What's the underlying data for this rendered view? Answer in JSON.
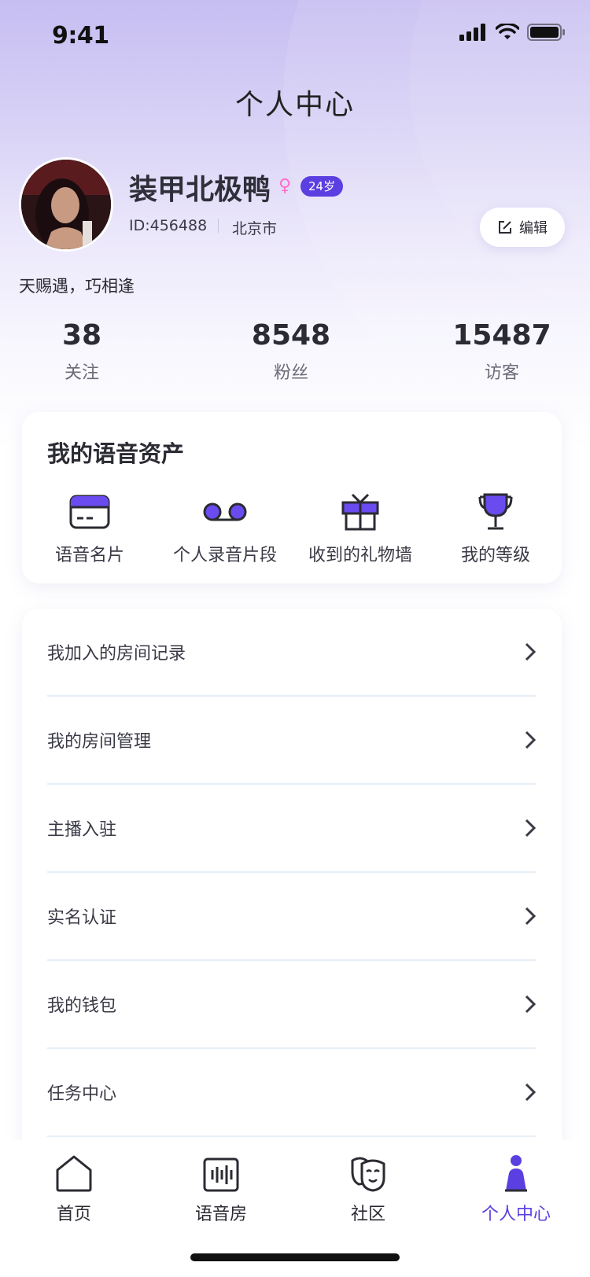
{
  "status_bar": {
    "time": "9:41"
  },
  "page": {
    "title": "个人中心"
  },
  "profile": {
    "name": "装甲北极鸭",
    "gender_icon": "♀",
    "age": "24岁",
    "id": "ID:456488",
    "city": "北京市",
    "signature": "天赐遇，巧相逢",
    "edit_label": "编辑"
  },
  "stats": [
    {
      "value": "38",
      "label": "关注"
    },
    {
      "value": "8548",
      "label": "粉丝"
    },
    {
      "value": "15487",
      "label": "访客"
    }
  ],
  "assets": {
    "title": "我的语音资产",
    "items": [
      {
        "label": "语音名片",
        "icon": "voice-card-icon"
      },
      {
        "label": "个人录音片段",
        "icon": "voicemail-icon"
      },
      {
        "label": "收到的礼物墙",
        "icon": "gift-icon"
      },
      {
        "label": "我的等级",
        "icon": "trophy-icon"
      }
    ]
  },
  "menu": [
    {
      "label": "我加入的房间记录"
    },
    {
      "label": "我的房间管理"
    },
    {
      "label": "主播入驻"
    },
    {
      "label": "实名认证"
    },
    {
      "label": "我的钱包"
    },
    {
      "label": "任务中心"
    }
  ],
  "tabbar": [
    {
      "label": "首页",
      "icon": "home-icon"
    },
    {
      "label": "语音房",
      "icon": "voice-room-icon"
    },
    {
      "label": "社区",
      "icon": "community-mask-icon"
    },
    {
      "label": "个人中心",
      "icon": "profile-icon",
      "active": true
    }
  ],
  "colors": {
    "accent": "#5b3fe0",
    "badge": "#5b3fe0",
    "female": "#ff6ec7"
  }
}
